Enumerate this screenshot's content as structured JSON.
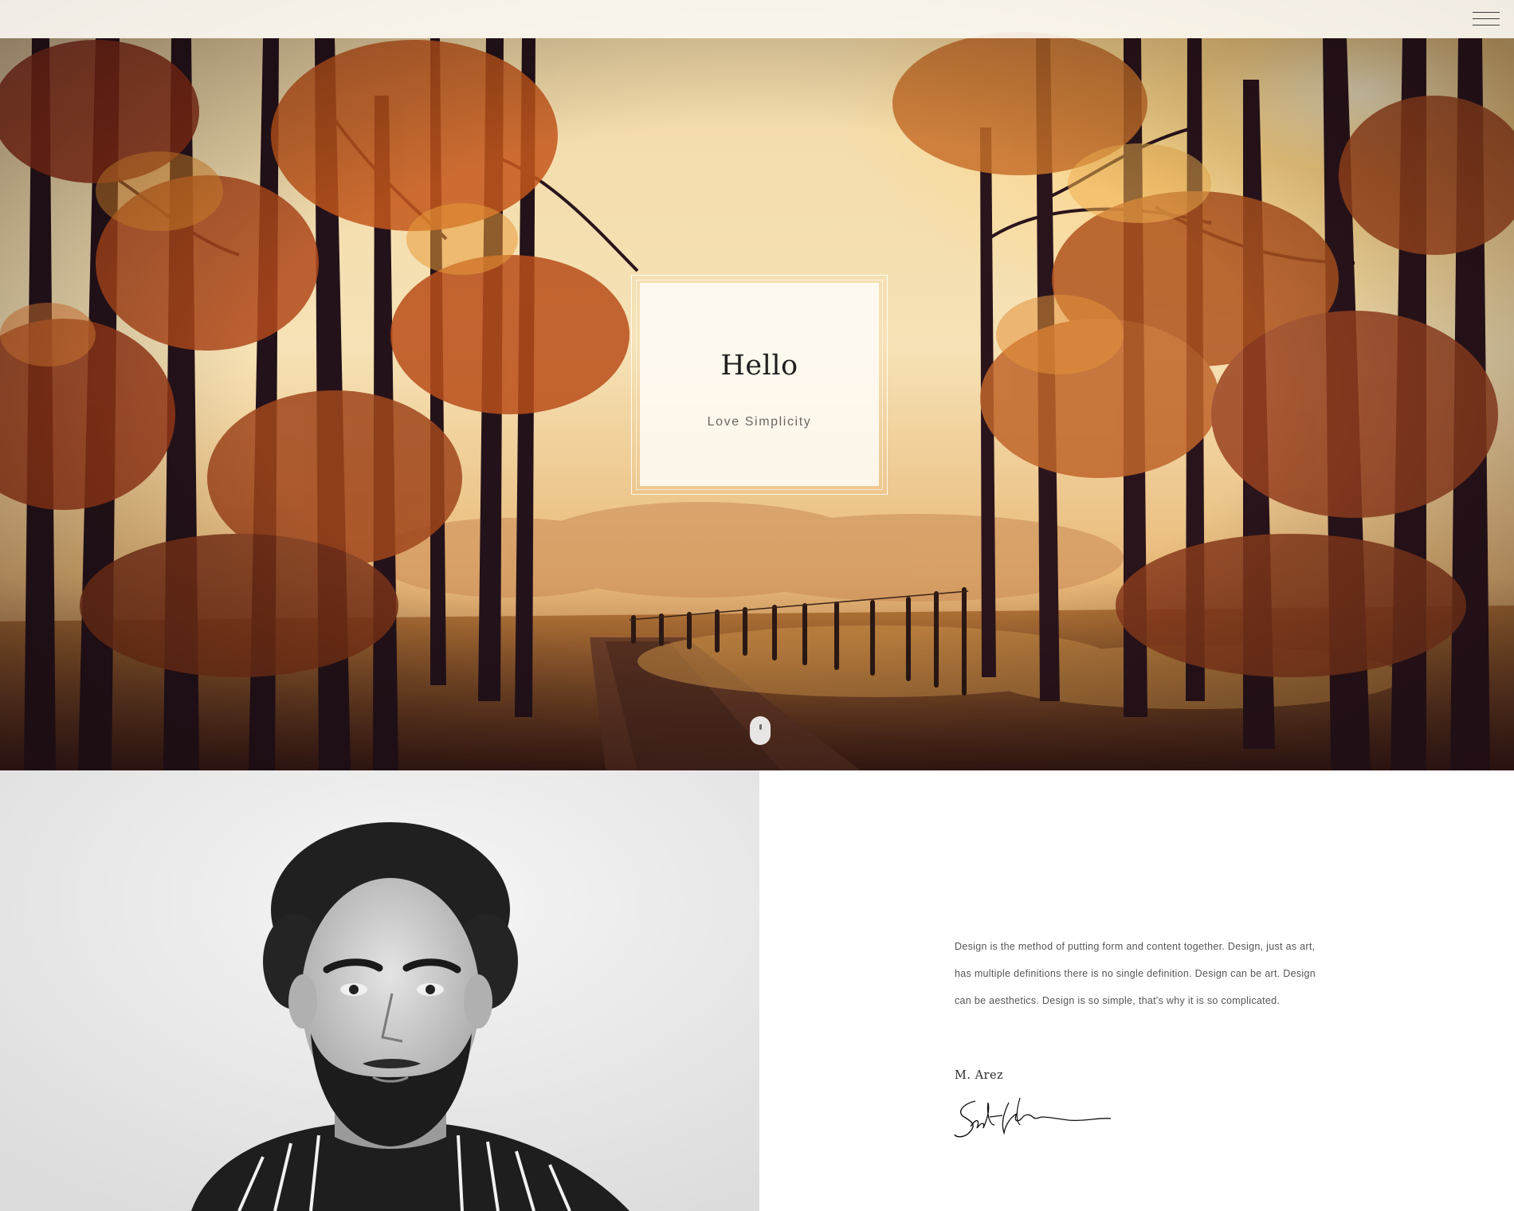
{
  "header": {
    "menu_icon": "hamburger-menu-icon"
  },
  "hero": {
    "title": "Hello",
    "subtitle": "Love Simplicity",
    "scroll_icon": "mouse-scroll-icon"
  },
  "about": {
    "text": "Design is the method of putting form and content together. Design, just as art, has multiple definitions there is no single definition. Design can be art. Design can be aesthetics. Design is so simple, that's why it is so complicated.",
    "author": "M. Arez",
    "signature_text": "Scott Lifman"
  },
  "colors": {
    "hero_sky": "#f7e2b0",
    "sun_glow": "#ffd27a",
    "foliage_orange": "#c4581c",
    "tree_dark": "#24121a",
    "card_bg": "#fffdf8",
    "text_dark": "#1f1f1f",
    "text_muted": "#555555"
  }
}
